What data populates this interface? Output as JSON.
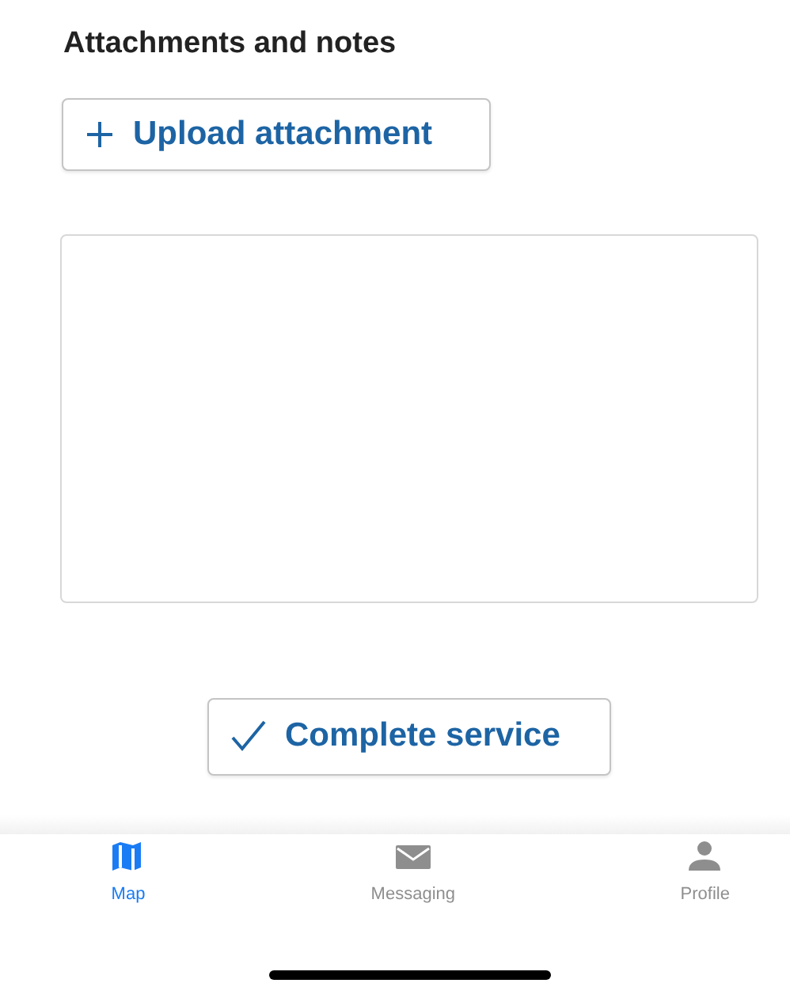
{
  "section": {
    "title": "Attachments and notes"
  },
  "upload_button": {
    "label": "Upload attachment"
  },
  "complete_button": {
    "label": "Complete service"
  },
  "tabs": [
    {
      "label": "Map",
      "kind": "map",
      "selected": true
    },
    {
      "label": "Messaging",
      "kind": "mail",
      "selected": false
    },
    {
      "label": "Profile",
      "kind": "person",
      "selected": false
    }
  ]
}
